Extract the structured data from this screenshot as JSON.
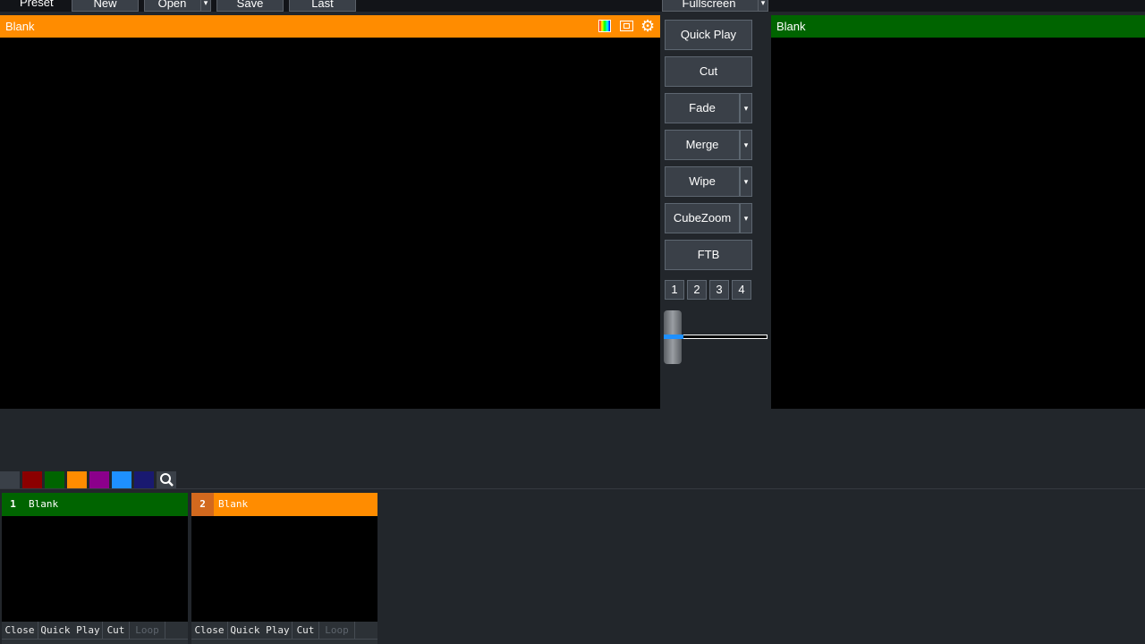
{
  "toolbar": {
    "preset_label": "Preset",
    "new_label": "New",
    "open_label": "Open",
    "save_label": "Save",
    "last_label": "Last",
    "fullscreen_label": "Fullscreen"
  },
  "preview": {
    "title": "Blank",
    "header_color": "#ff8c00",
    "icons": [
      "color-bars-icon",
      "screen-icon",
      "gear-icon"
    ]
  },
  "output": {
    "title": "Blank",
    "header_color": "#006400"
  },
  "transitions": {
    "quick_play": "Quick Play",
    "cut": "Cut",
    "fade": "Fade",
    "merge": "Merge",
    "wipe": "Wipe",
    "cubezoom": "CubeZoom",
    "ftb": "FTB",
    "numbers": [
      "1",
      "2",
      "3",
      "4"
    ],
    "tbar_level": 0.0
  },
  "color_filters": [
    "#3a4048",
    "#8b0000",
    "#006400",
    "#ff8c00",
    "#8b008b",
    "#1e90ff",
    "#191970"
  ],
  "inputs": [
    {
      "number": "1",
      "title": "Blank",
      "color": "#006400",
      "buttons": {
        "close": "Close",
        "quick_play": "Quick Play",
        "cut": "Cut",
        "loop": "Loop"
      }
    },
    {
      "number": "2",
      "title": "Blank",
      "color": "#ff8c00",
      "buttons": {
        "close": "Close",
        "quick_play": "Quick Play",
        "cut": "Cut",
        "loop": "Loop"
      }
    }
  ]
}
